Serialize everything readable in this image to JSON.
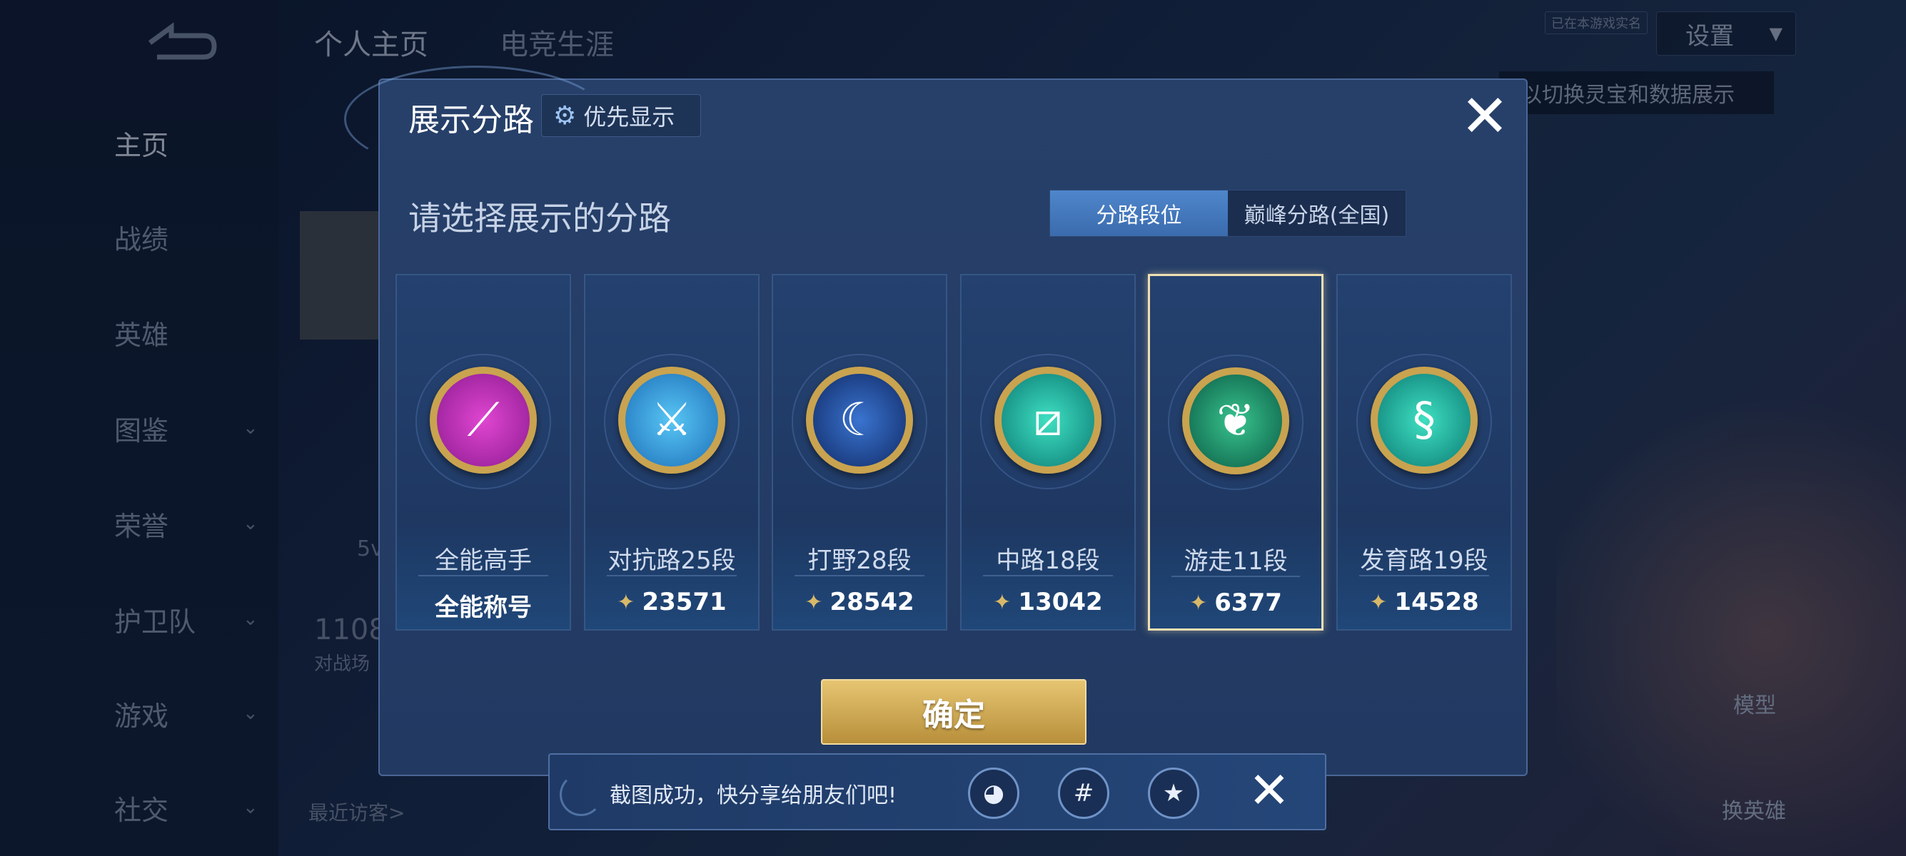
{
  "background": {
    "nav_items": [
      {
        "label": "主页",
        "active": true
      },
      {
        "label": "战绩"
      },
      {
        "label": "英雄"
      },
      {
        "label": "图鉴",
        "chevron": true
      },
      {
        "label": "荣誉",
        "chevron": true
      },
      {
        "label": "护卫队",
        "chevron": true
      },
      {
        "label": "游戏",
        "chevron": true
      },
      {
        "label": "社交",
        "chevron": true
      }
    ],
    "top_tabs": [
      "个人主页",
      "电竞生涯"
    ],
    "realname_tag": "已在本游戏实名",
    "settings_label": "设置",
    "hint_text": "以切换灵宝和数据展示",
    "left_number": "1108",
    "left_caption": "对战场",
    "left_small": "5v",
    "recent_visitors": "最近访客>",
    "model_label": "模型",
    "switch_hero_label": "换英雄"
  },
  "modal": {
    "title": "展示分路",
    "priority_label": "优先显示",
    "subtitle": "请选择展示的分路",
    "toggle": [
      "分路段位",
      "巅峰分路(全国)"
    ],
    "cards": [
      {
        "name": "全能高手",
        "value": "全能称号",
        "badge": "purple",
        "glyph": "⟋",
        "show_points_icon": false
      },
      {
        "name": "对抗路25段",
        "value": "23571",
        "badge": "blue",
        "glyph": "⚔",
        "show_points_icon": true
      },
      {
        "name": "打野28段",
        "value": "28542",
        "badge": "navy",
        "glyph": "☾",
        "show_points_icon": true
      },
      {
        "name": "中路18段",
        "value": "13042",
        "badge": "teal",
        "glyph": "⧄",
        "show_points_icon": true
      },
      {
        "name": "游走11段",
        "value": "6377",
        "badge": "green",
        "glyph": "❦",
        "show_points_icon": true,
        "selected": true
      },
      {
        "name": "发育路19段",
        "value": "14528",
        "badge": "teal",
        "glyph": "§",
        "show_points_icon": true
      }
    ],
    "confirm_label": "确定"
  },
  "toast": {
    "text": "截图成功，快分享给朋友们吧!",
    "share_icons": [
      "qq-icon",
      "wechat-icon",
      "qzone-icon"
    ]
  },
  "colors": {
    "accent_gold": "#d9b868",
    "selected_border": "#f0dfb2",
    "toggle_active": "#4f86cc"
  }
}
